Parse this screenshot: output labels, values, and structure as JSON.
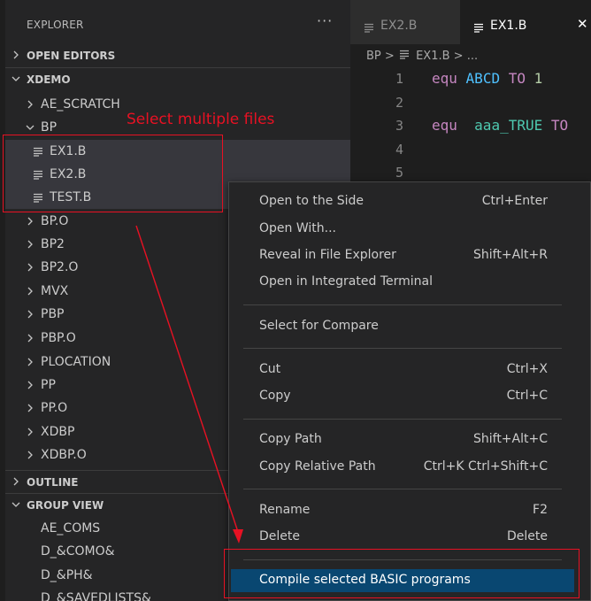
{
  "sidebar": {
    "header": "EXPLORER",
    "more_icon": "ellipsis-icon",
    "sections": {
      "open_editors": "OPEN EDITORS",
      "workspace": "XDEMO",
      "outline": "OUTLINE",
      "group_view": "GROUP VIEW"
    },
    "tree": {
      "ae_scratch": "AE_SCRATCH",
      "bp": "BP",
      "ex1": "EX1.B",
      "ex2": "EX2.B",
      "test": "TEST.B",
      "bp_o": "BP.O",
      "bp2": "BP2",
      "bp2_o": "BP2.O",
      "mvx": "MVX",
      "pbp": "PBP",
      "pbp_o": "PBP.O",
      "plocation": "PLOCATION",
      "pp": "PP",
      "pp_o": "PP.O",
      "xdbp": "XDBP",
      "xdbp_o": "XDBP.O"
    },
    "group": {
      "ae_coms": "AE_COMS",
      "d_como": "D_&COMO&",
      "d_ph": "D_&PH&",
      "d_savedlists": "D_&SAVEDLISTS&"
    }
  },
  "annotation": {
    "select_label": "Select multiple files",
    "color": "#e81123"
  },
  "editor": {
    "tabs": {
      "tab1": "EX2.B",
      "tab2": "EX1.B"
    },
    "breadcrumb": {
      "folder": "BP",
      "file": "EX1.B",
      "more": "..."
    },
    "lines": [
      "1",
      "2",
      "3",
      "4",
      "5"
    ],
    "code": {
      "l1_kw": "equ",
      "l1_id": "ABCD",
      "l1_to": "TO",
      "l1_num": "1",
      "l3_kw": "equ",
      "l3_id": "aaa_TRUE",
      "l3_to": "TO"
    }
  },
  "context_menu": {
    "open_side": "Open to the Side",
    "open_side_key": "Ctrl+Enter",
    "open_with": "Open With...",
    "reveal": "Reveal in File Explorer",
    "reveal_key": "Shift+Alt+R",
    "terminal": "Open in Integrated Terminal",
    "compare": "Select for Compare",
    "cut": "Cut",
    "cut_key": "Ctrl+X",
    "copy": "Copy",
    "copy_key": "Ctrl+C",
    "copy_path": "Copy Path",
    "copy_path_key": "Shift+Alt+C",
    "copy_rel": "Copy Relative Path",
    "copy_rel_key": "Ctrl+K Ctrl+Shift+C",
    "rename": "Rename",
    "rename_key": "F2",
    "delete": "Delete",
    "delete_key": "Delete",
    "compile": "Compile selected BASIC programs"
  },
  "colors": {
    "sidebar_bg": "#252526",
    "editor_bg": "#1e1e1e",
    "selection": "#37373d",
    "menu_highlight": "#094771"
  }
}
